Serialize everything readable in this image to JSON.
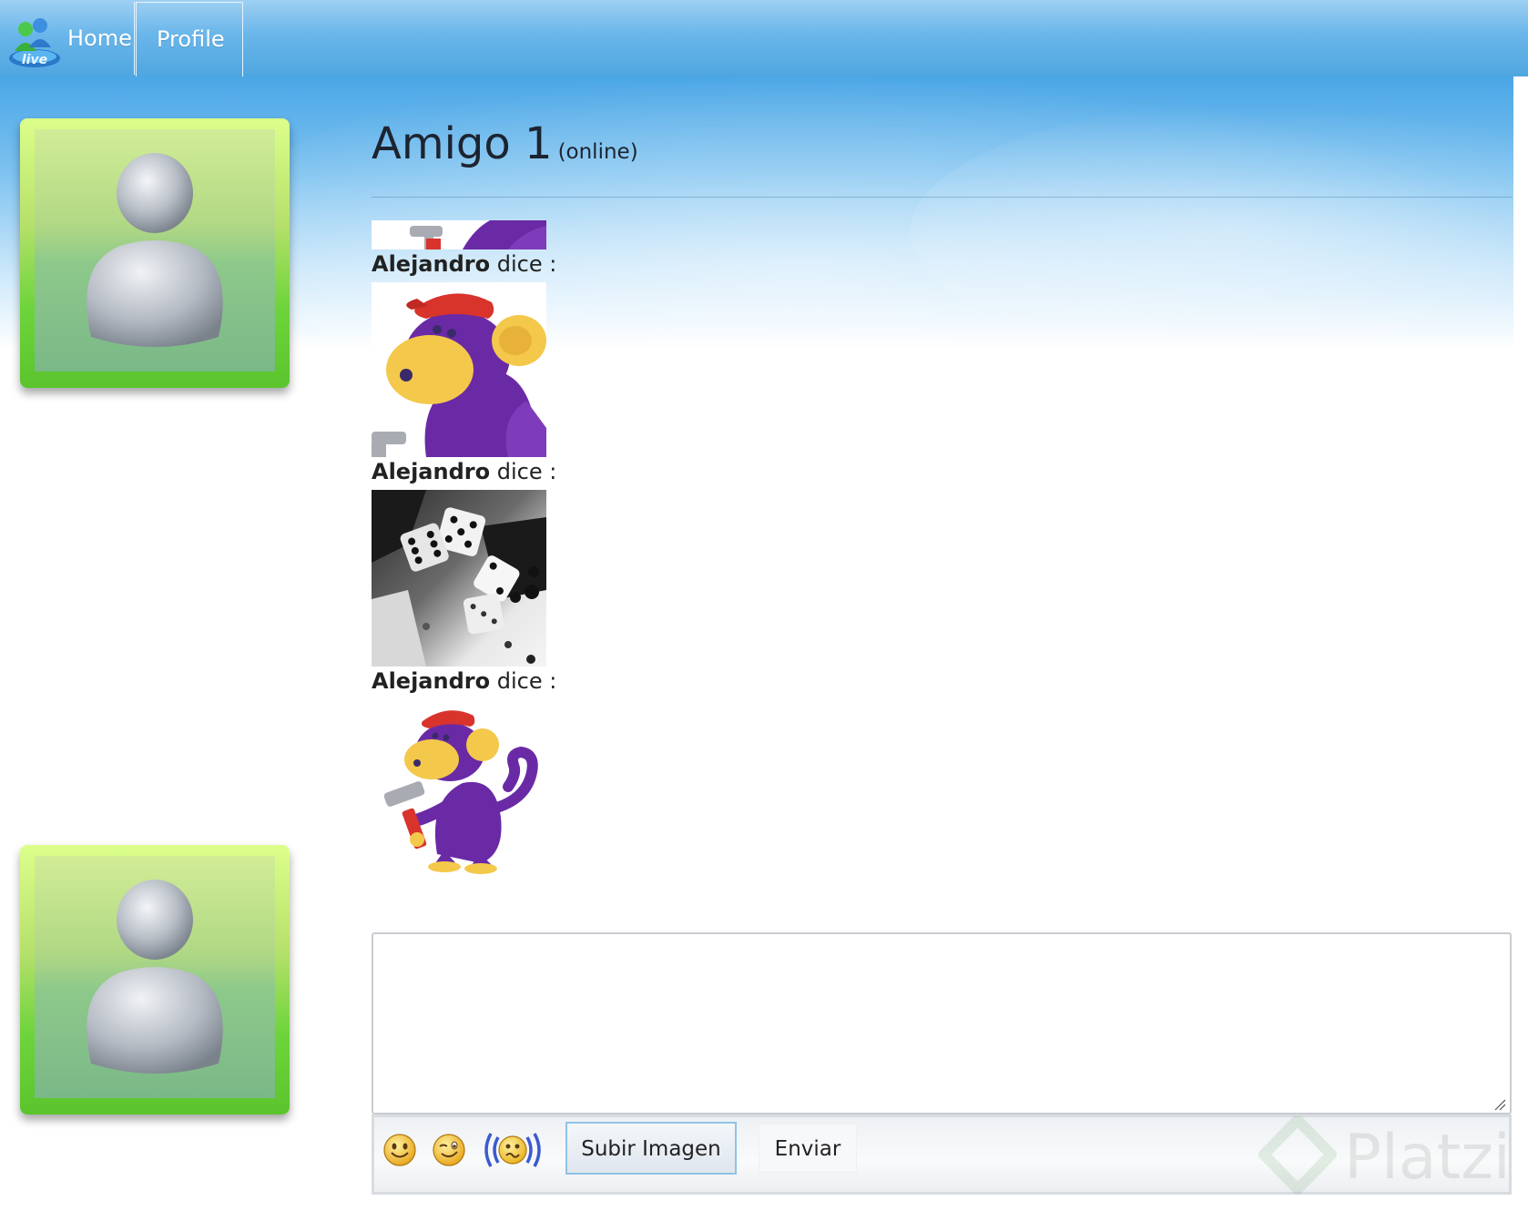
{
  "nav": {
    "home_label": "Home",
    "profile_label": "Profile"
  },
  "contact": {
    "name": "Amigo 1",
    "status": "(online)"
  },
  "messages": [
    {
      "author": "Alejandro",
      "verb": "dice :"
    },
    {
      "author": "Alejandro",
      "verb": "dice :"
    },
    {
      "author": "Alejandro",
      "verb": "dice :"
    }
  ],
  "composer": {
    "value": "",
    "placeholder": ""
  },
  "toolbar": {
    "emoticons": [
      "smile-emoticon",
      "wink-emoticon",
      "nudge-emoticon"
    ],
    "upload_label": "Subir Imagen",
    "send_label": "Enviar"
  },
  "watermark": {
    "text": "Platzi"
  },
  "colors": {
    "navbar": "#5aaee5",
    "avatar_frame": "#6ed43c",
    "upload_border": "#8fc3e6"
  }
}
